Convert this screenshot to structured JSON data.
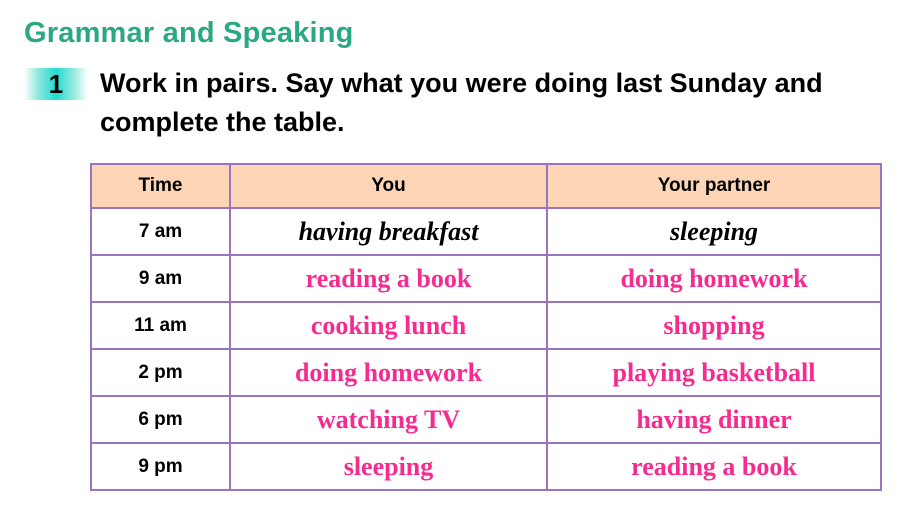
{
  "section": {
    "title": "Grammar and Speaking",
    "title_color": "#2BA882"
  },
  "task": {
    "number": "1",
    "instruction": "Work in pairs. Say what you were doing last Sunday and complete the table.",
    "badge_gradient_color": "#22dbd0"
  },
  "table": {
    "header_background": "#FBD5B5",
    "border_color": "#9B74C0",
    "answer_color": "#F72B8F",
    "example_color": "#000000",
    "columns": [
      "Time",
      "You",
      "Your partner"
    ],
    "rows": [
      {
        "time": "7 am",
        "you": "having breakfast",
        "partner": "sleeping",
        "style": "example"
      },
      {
        "time": "9 am",
        "you": "reading a book",
        "partner": "doing homework",
        "style": "answer"
      },
      {
        "time": "11 am",
        "you": "cooking lunch",
        "partner": "shopping",
        "style": "answer"
      },
      {
        "time": "2 pm",
        "you": "doing homework",
        "partner": "playing basketball",
        "style": "answer"
      },
      {
        "time": "6 pm",
        "you": "watching TV",
        "partner": "having dinner",
        "style": "answer"
      },
      {
        "time": "9 pm",
        "you": "sleeping",
        "partner": "reading a book",
        "style": "answer"
      }
    ]
  }
}
